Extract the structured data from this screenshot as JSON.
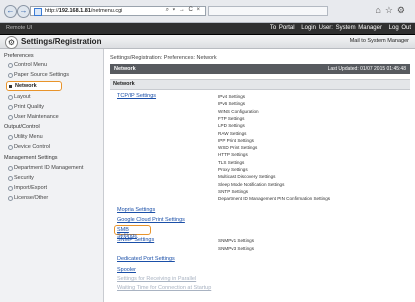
{
  "browser": {
    "url_prefix": "http://",
    "url_host": "192.168.1.81",
    "url_path": "/netmenu.cgi",
    "addr_glyphs": "⌕ ▾ → C ×",
    "toolbar_glyphs": "⌂☆⚙"
  },
  "topbar": {
    "device_name": "Remote UI",
    "to_portal": "To Portal",
    "login_user": "Login User: System Manager",
    "logout": "Log Out"
  },
  "titlebar": {
    "title": "Settings/Registration",
    "mail": "Mail to System Manager"
  },
  "sidebar": {
    "preferences": "Preferences",
    "control_menu": "Control Menu",
    "paper_source": "Paper Source Settings",
    "network": "Network",
    "layout": "Layout",
    "print_quality": "Print Quality",
    "user_maintenance": "User Maintenance",
    "output_control": "Output/Control",
    "utility_menu": "Utility Menu",
    "device_control": "Device Control",
    "management": "Management Settings",
    "dept_id": "Department ID Management",
    "security": "Security",
    "import_export": "Import/Export",
    "license_other": "License/Other"
  },
  "main": {
    "breadcrumb": "Settings/Registration: Preferences: Network",
    "header": "Network",
    "last_updated": "Last Updated: 01/07 2015 01:45:48",
    "section": "Network",
    "tcpip": "TCP/IP Settings",
    "tcpip_items": [
      "IPv4 Settings",
      "IPv6 Settings",
      "WINS Configuration",
      "FTP Settings",
      "LPD Settings",
      "RAW Settings",
      "IPP Print Settings",
      "WSD Print Settings",
      "HTTP Settings",
      "TLS Settings",
      "Proxy Settings",
      "Multicast Discovery Settings",
      "Sleep Mode Notification Settings",
      "SNTP Settings",
      "Department ID Management PIN Confirmation Settings"
    ],
    "mopria": "Mopria Settings",
    "gcp": "Google Cloud Print Settings",
    "smb": "SMB Settings",
    "snmp": "SNMP Settings",
    "snmp_items": [
      "SNMPv1 Settings",
      "SNMPv3 Settings"
    ],
    "dedicated_port": "Dedicated Port Settings",
    "spooler": "Spooler",
    "receiving_parallel": "Settings for Receiving in Parallel",
    "waiting_time": "Waiting Time for Connection at Startup"
  }
}
